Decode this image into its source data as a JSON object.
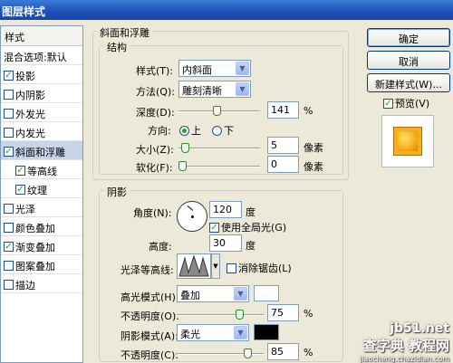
{
  "window": {
    "title": "图层样式"
  },
  "styles_panel": {
    "header": "样式",
    "items": [
      {
        "label": "混合选项:默认",
        "checkbox": false,
        "checked": false,
        "selected": false,
        "sub": false
      },
      {
        "label": "投影",
        "checkbox": true,
        "checked": true,
        "selected": false,
        "sub": false
      },
      {
        "label": "内阴影",
        "checkbox": true,
        "checked": false,
        "selected": false,
        "sub": false
      },
      {
        "label": "外发光",
        "checkbox": true,
        "checked": false,
        "selected": false,
        "sub": false
      },
      {
        "label": "内发光",
        "checkbox": true,
        "checked": false,
        "selected": false,
        "sub": false
      },
      {
        "label": "斜面和浮雕",
        "checkbox": true,
        "checked": true,
        "selected": true,
        "sub": false
      },
      {
        "label": "等高线",
        "checkbox": true,
        "checked": true,
        "selected": false,
        "sub": true
      },
      {
        "label": "纹理",
        "checkbox": true,
        "checked": true,
        "selected": false,
        "sub": true
      },
      {
        "label": "光泽",
        "checkbox": true,
        "checked": false,
        "selected": false,
        "sub": false
      },
      {
        "label": "颜色叠加",
        "checkbox": true,
        "checked": false,
        "selected": false,
        "sub": false
      },
      {
        "label": "渐变叠加",
        "checkbox": true,
        "checked": true,
        "selected": false,
        "sub": false
      },
      {
        "label": "图案叠加",
        "checkbox": true,
        "checked": false,
        "selected": false,
        "sub": false
      },
      {
        "label": "描边",
        "checkbox": true,
        "checked": false,
        "selected": false,
        "sub": false
      }
    ]
  },
  "bevel": {
    "section_title": "斜面和浮雕",
    "structure_title": "结构",
    "style_label": "样式(T):",
    "style_value": "内斜面",
    "technique_label": "方法(Q):",
    "technique_value": "雕刻清晰",
    "depth_label": "深度(D):",
    "depth_value": "141",
    "depth_unit": "%",
    "depth_level": 0.47,
    "direction_label": "方向:",
    "direction_up": "上",
    "direction_down": "下",
    "size_label": "大小(Z):",
    "size_value": "5",
    "size_unit": "像素",
    "size_level": 0.04,
    "soften_label": "软化(F):",
    "soften_value": "0",
    "soften_unit": "像素",
    "soften_level": 0.0
  },
  "shading": {
    "section_title": "阴影",
    "angle_label": "角度(N):",
    "angle_value": "120",
    "angle_unit": "度",
    "global_light_label": "使用全局光(G)",
    "altitude_label": "高度:",
    "altitude_value": "30",
    "altitude_unit": "度",
    "gloss_contour_label": "光泽等高线:",
    "antialias_label": "消除锯齿(L)",
    "highlight_mode_label": "高光模式(H):",
    "highlight_mode_value": "叠加",
    "highlight_color": "#ffffff",
    "highlight_opacity_label": "不透明度(O):",
    "highlight_opacity_value": "75",
    "highlight_opacity_unit": "%",
    "highlight_opacity_level": 0.75,
    "shadow_mode_label": "阴影模式(A):",
    "shadow_mode_value": "柔光",
    "shadow_color": "#000000",
    "shadow_opacity_label": "不透明度(C):",
    "shadow_opacity_value": "85",
    "shadow_opacity_unit": "%",
    "shadow_opacity_level": 0.85
  },
  "buttons": {
    "ok": "确定",
    "cancel": "取消",
    "new_style": "新建样式(W)...",
    "preview_label": "预览(V)"
  },
  "watermark": {
    "line1": "jb51.net",
    "line2": "查字典 教程网",
    "line3": "jiaocheng.chazidian.com"
  }
}
